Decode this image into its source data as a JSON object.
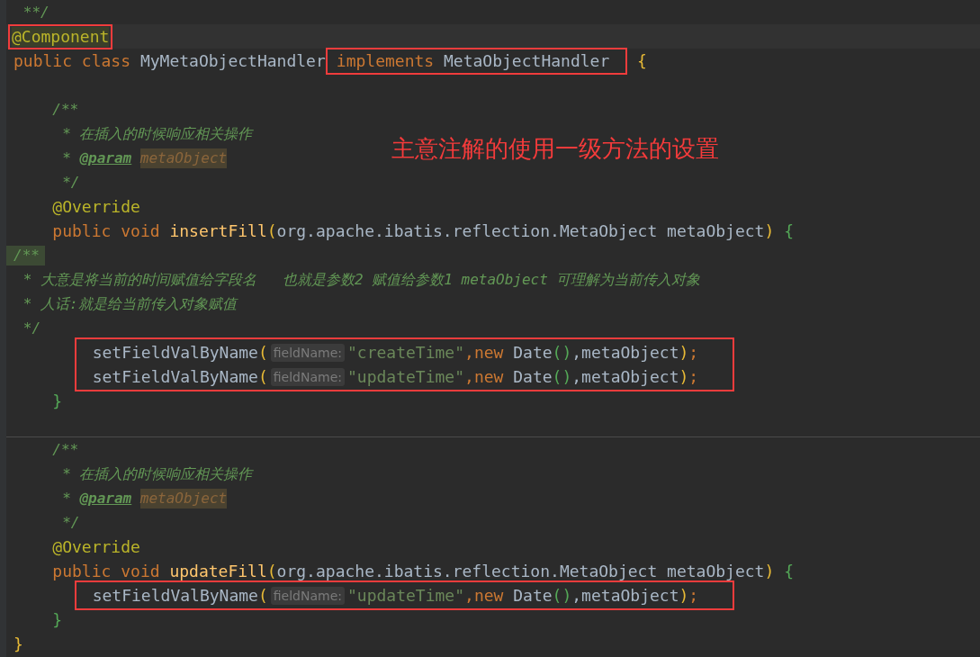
{
  "caption": "主意注解的使用一级方法的设置",
  "lines": [
    {
      "kind": "doc",
      "tokens": [
        {
          "text": "**/",
          "kind": "comment"
        }
      ]
    },
    {
      "kind": "code",
      "current": true,
      "tokens": [
        {
          "text": "@Component",
          "kind": "annotation",
          "highlighted": true,
          "boxed": true
        }
      ]
    },
    {
      "kind": "code",
      "tokens": [
        {
          "text": "public class ",
          "kind": "keyword"
        },
        {
          "text": "MyMetaObjectHandler",
          "kind": "plain"
        },
        {
          "text": "implements ",
          "kind": "keyword",
          "boxed": true
        },
        {
          "text": "MetaObjectHandler",
          "kind": "plain",
          "boxed": true
        },
        {
          "text": "{",
          "kind": "open-brace-outer"
        }
      ],
      "children": [
        {
          "kind": "blank"
        },
        {
          "kind": "code",
          "tokens": [
            {
              "text": "/**",
              "kind": "comment"
            }
          ]
        },
        {
          "kind": "doc",
          "tokens": [
            {
              "text": "* 在插入的时候响应相关操作",
              "kind": "comment"
            }
          ]
        },
        {
          "kind": "doc",
          "tokens": [
            {
              "text": "* ",
              "kind": "comment"
            },
            {
              "text": "@param",
              "kind": "doc-tag"
            },
            {
              "text": "metaObject",
              "kind": "doc-ref",
              "highlighted": true
            }
          ]
        },
        {
          "kind": "doc",
          "tokens": [
            {
              "text": "*/",
              "kind": "comment"
            }
          ]
        },
        {
          "kind": "code",
          "tokens": [
            {
              "text": "@Override",
              "kind": "annotation"
            }
          ]
        },
        {
          "kind": "code",
          "tokens": [
            {
              "text": "public void ",
              "kind": "keyword"
            },
            {
              "text": "insertFill",
              "kind": "method"
            },
            {
              "text": "(",
              "kind": "bracket-outer"
            },
            {
              "text": "org.apache.ibatis.reflection.MetaObject metaObject",
              "kind": "plain"
            },
            {
              "text": ")",
              "kind": "bracket-outer"
            },
            {
              "text": "{",
              "kind": "open-brace-inner"
            }
          ],
          "children": [
            {
              "kind": "flush",
              "tokens": [
                {
                  "text": "/**",
                  "kind": "comment",
                  "highlighted": true
                }
              ]
            },
            {
              "kind": "flush-doc",
              "tokens": [
                {
                  "text": "* 大意是将当前的时间赋值给字段名   也就是参数2 赋值给参数1 metaObject 可理解为当前传入对象",
                  "kind": "comment"
                }
              ]
            },
            {
              "kind": "flush-doc",
              "tokens": [
                {
                  "text": "* 人话:就是给当前传入对象赋值",
                  "kind": "comment"
                }
              ]
            },
            {
              "kind": "flush-doc",
              "tokens": [
                {
                  "text": "*/",
                  "kind": "comment"
                }
              ]
            },
            {
              "kind": "frame",
              "children": [
                {
                  "kind": "code",
                  "tokens": [
                    {
                      "text": "setFieldValByName",
                      "kind": "plain"
                    },
                    {
                      "text": "(",
                      "kind": "bracket-outer"
                    },
                    {
                      "text": "fieldName:",
                      "kind": "hint"
                    },
                    {
                      "text": "\"createTime\"",
                      "kind": "string"
                    },
                    {
                      "text": ",new ",
                      "kind": "keyword"
                    },
                    {
                      "text": "Date",
                      "kind": "plain"
                    },
                    {
                      "text": "()",
                      "kind": "bracket-inner"
                    },
                    {
                      "text": ",metaObject",
                      "kind": "plain"
                    },
                    {
                      "text": ")",
                      "kind": "bracket-outer"
                    },
                    {
                      "text": ";",
                      "kind": "keyword"
                    }
                  ]
                },
                {
                  "kind": "code",
                  "tokens": [
                    {
                      "text": "setFieldValByName",
                      "kind": "plain"
                    },
                    {
                      "text": "(",
                      "kind": "bracket-outer"
                    },
                    {
                      "text": "fieldName:",
                      "kind": "hint"
                    },
                    {
                      "text": "\"updateTime\"",
                      "kind": "string"
                    },
                    {
                      "text": ",new ",
                      "kind": "keyword"
                    },
                    {
                      "text": "Date",
                      "kind": "plain"
                    },
                    {
                      "text": "()",
                      "kind": "bracket-inner"
                    },
                    {
                      "text": ",metaObject",
                      "kind": "plain"
                    },
                    {
                      "text": ")",
                      "kind": "bracket-outer"
                    },
                    {
                      "text": ";",
                      "kind": "keyword"
                    }
                  ]
                }
              ]
            }
          ]
        },
        {
          "kind": "code",
          "tokens": [
            {
              "text": "}",
              "kind": "bracket-inner"
            }
          ]
        },
        {
          "kind": "blank"
        },
        {
          "kind": "code",
          "divider_above": true,
          "tokens": [
            {
              "text": "/**",
              "kind": "comment"
            }
          ]
        },
        {
          "kind": "doc",
          "tokens": [
            {
              "text": "* 在插入的时候响应相关操作",
              "kind": "comment"
            }
          ]
        },
        {
          "kind": "doc",
          "tokens": [
            {
              "text": "* ",
              "kind": "comment"
            },
            {
              "text": "@param",
              "kind": "doc-tag"
            },
            {
              "text": "metaObject",
              "kind": "doc-ref",
              "highlighted": true
            }
          ]
        },
        {
          "kind": "doc",
          "tokens": [
            {
              "text": "*/",
              "kind": "comment"
            }
          ]
        },
        {
          "kind": "code",
          "tokens": [
            {
              "text": "@Override",
              "kind": "annotation"
            }
          ]
        },
        {
          "kind": "code",
          "tokens": [
            {
              "text": "public void ",
              "kind": "keyword"
            },
            {
              "text": "updateFill",
              "kind": "method"
            },
            {
              "text": "(",
              "kind": "bracket-outer"
            },
            {
              "text": "org.apache.ibatis.reflection.MetaObject metaObject",
              "kind": "plain"
            },
            {
              "text": ")",
              "kind": "bracket-outer"
            },
            {
              "text": "{",
              "kind": "open-brace-inner"
            }
          ],
          "children": [
            {
              "kind": "frame",
              "children": [
                {
                  "kind": "code",
                  "tokens": [
                    {
                      "text": "setFieldValByName",
                      "kind": "plain"
                    },
                    {
                      "text": "(",
                      "kind": "bracket-outer"
                    },
                    {
                      "text": "fieldName:",
                      "kind": "hint"
                    },
                    {
                      "text": "\"updateTime\"",
                      "kind": "string"
                    },
                    {
                      "text": ",new ",
                      "kind": "keyword"
                    },
                    {
                      "text": "Date",
                      "kind": "plain"
                    },
                    {
                      "text": "()",
                      "kind": "bracket-inner"
                    },
                    {
                      "text": ",metaObject",
                      "kind": "plain"
                    },
                    {
                      "text": ")",
                      "kind": "bracket-outer"
                    },
                    {
                      "text": ";",
                      "kind": "keyword"
                    }
                  ]
                }
              ]
            }
          ]
        },
        {
          "kind": "code",
          "tokens": [
            {
              "text": "}",
              "kind": "bracket-inner"
            }
          ]
        }
      ]
    },
    {
      "kind": "code",
      "tokens": [
        {
          "text": "}",
          "kind": "bracket-outer"
        }
      ]
    }
  ]
}
